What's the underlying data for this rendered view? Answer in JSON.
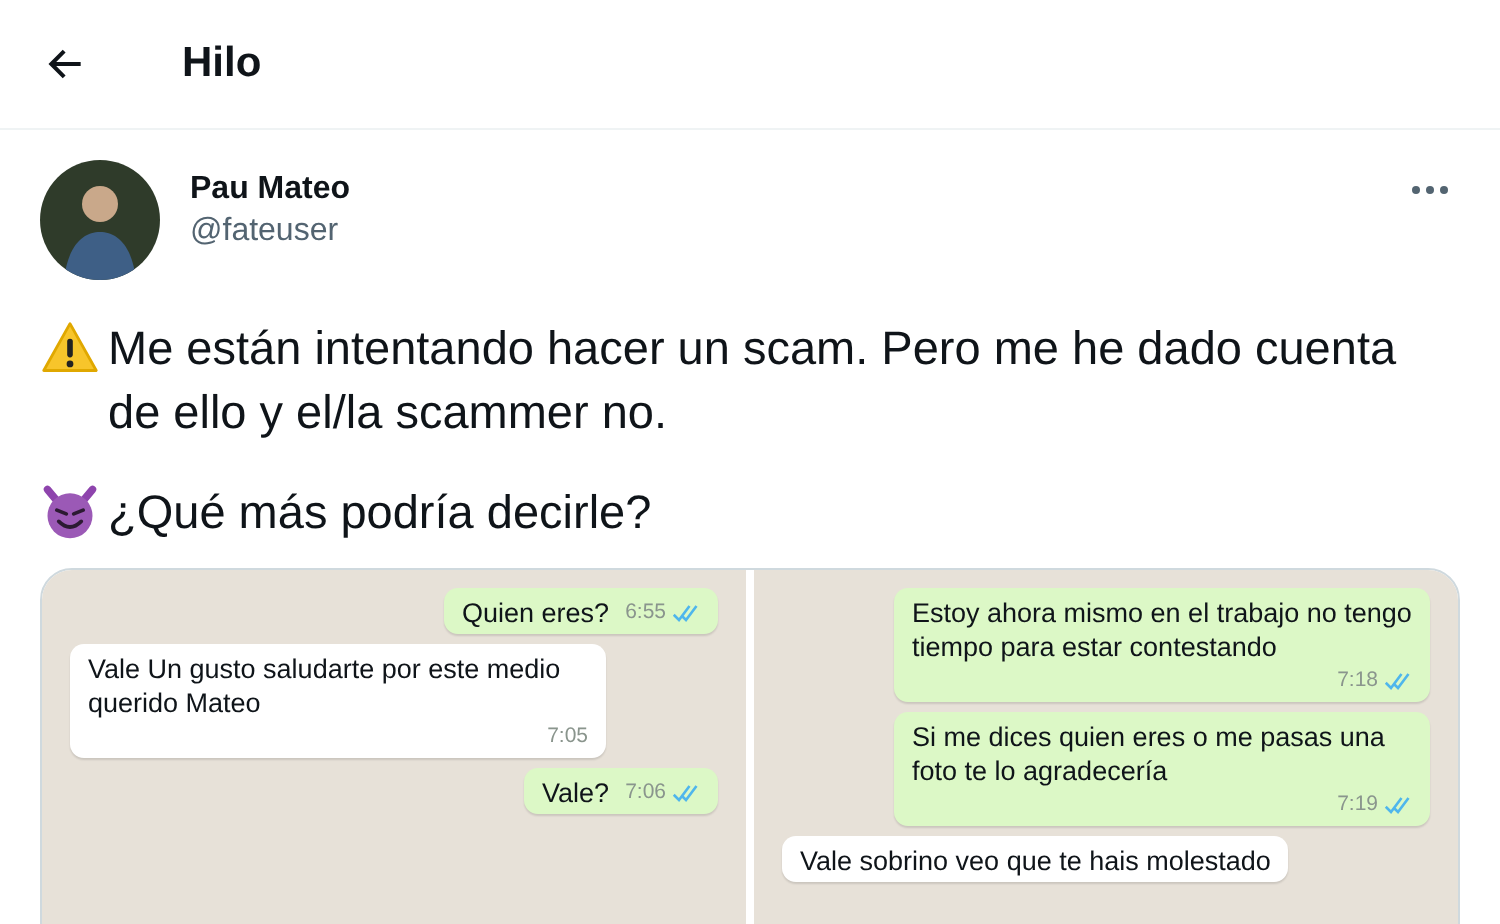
{
  "header": {
    "title": "Hilo"
  },
  "author": {
    "name": "Pau Mateo",
    "handle": "@fateuser"
  },
  "tweet": {
    "paragraphs": [
      {
        "kind": "warning",
        "text": "Me están intentando hacer un scam. Pero me he dado cuenta de ello y el/la scammer no."
      },
      {
        "kind": "devil",
        "text": "¿Qué más podría decirle?"
      }
    ]
  },
  "chat_panels": [
    {
      "messages": [
        {
          "kind": "sent",
          "text": "Quien eres?",
          "time": "6:55"
        },
        {
          "kind": "received",
          "text": "Vale Un gusto saludarte por este medio querido Mateo",
          "time": "7:05"
        },
        {
          "kind": "sent",
          "text": "Vale?",
          "time": "7:06"
        }
      ]
    },
    {
      "messages": [
        {
          "kind": "sent",
          "text": "Estoy ahora mismo en el trabajo no tengo tiempo para estar contestando",
          "time": "7:18"
        },
        {
          "kind": "sent",
          "text": "Si me dices quien eres o me pasas una foto te lo agradecería",
          "time": "7:19"
        },
        {
          "kind": "received",
          "text": "Vale sobrino veo que te hais molestado"
        }
      ]
    }
  ]
}
